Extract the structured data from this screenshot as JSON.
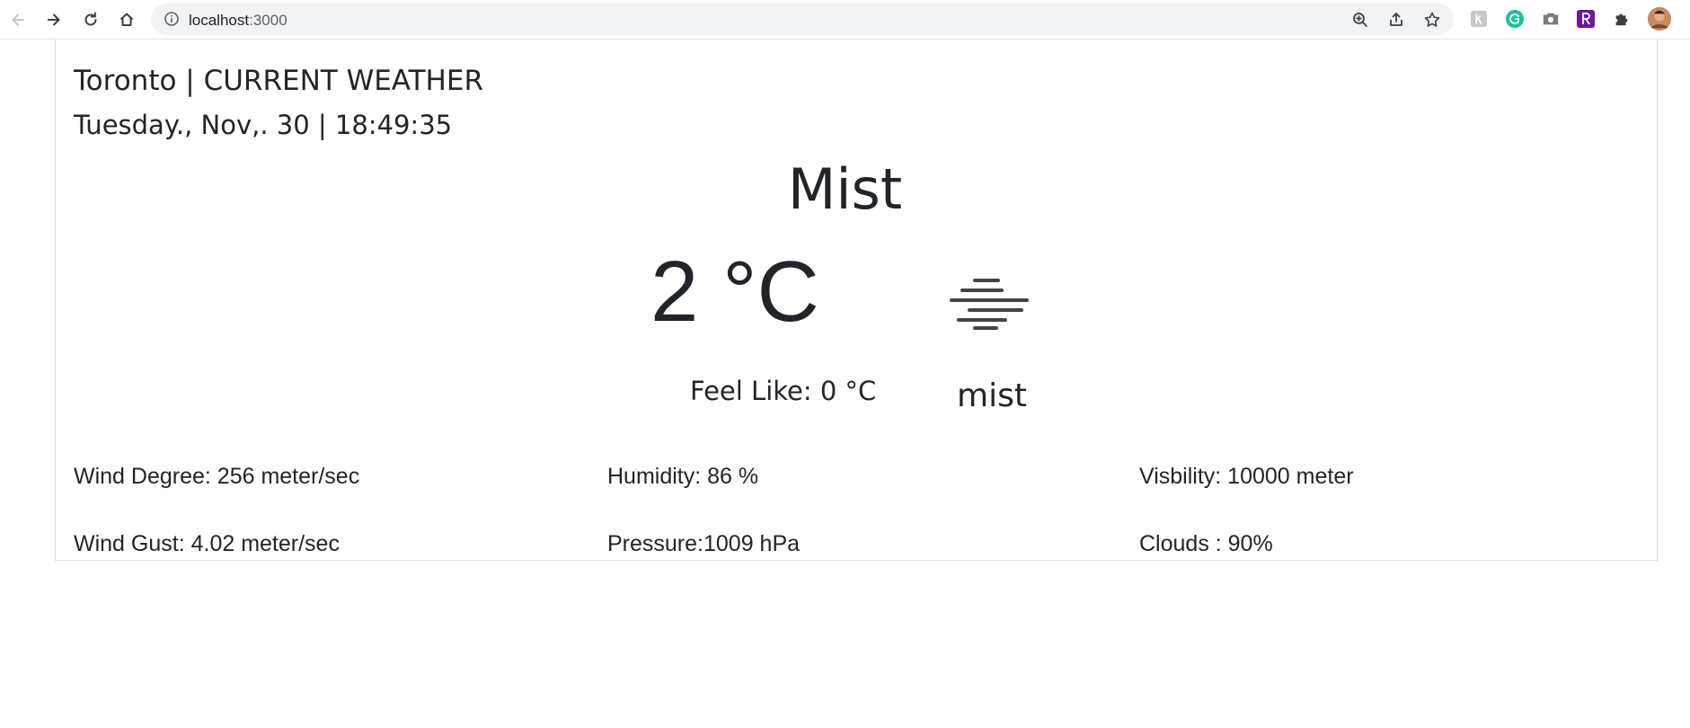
{
  "browser": {
    "url_host": "localhost",
    "url_port": ":3000"
  },
  "weather": {
    "city_heading": "Toronto | CURRENT WEATHER",
    "datetime": "Tuesday., Nov,. 30 | 18:49:35",
    "condition": "Mist",
    "temperature": "2 °C",
    "feels_like": "Feel Like: 0 °C",
    "description": "mist",
    "icon": "mist-icon"
  },
  "stats": {
    "wind_degree": "Wind Degree: 256 meter/sec",
    "humidity": "Humidity: 86 %",
    "visibility": "Visbility: 10000 meter",
    "wind_gust": "Wind Gust: 4.02 meter/sec",
    "pressure": "Pressure:1009 hPa",
    "clouds": "Clouds : 90%"
  },
  "colors": {
    "text": "#212529",
    "border": "#dcdcdc",
    "omnibox": "#f1f3f4"
  }
}
